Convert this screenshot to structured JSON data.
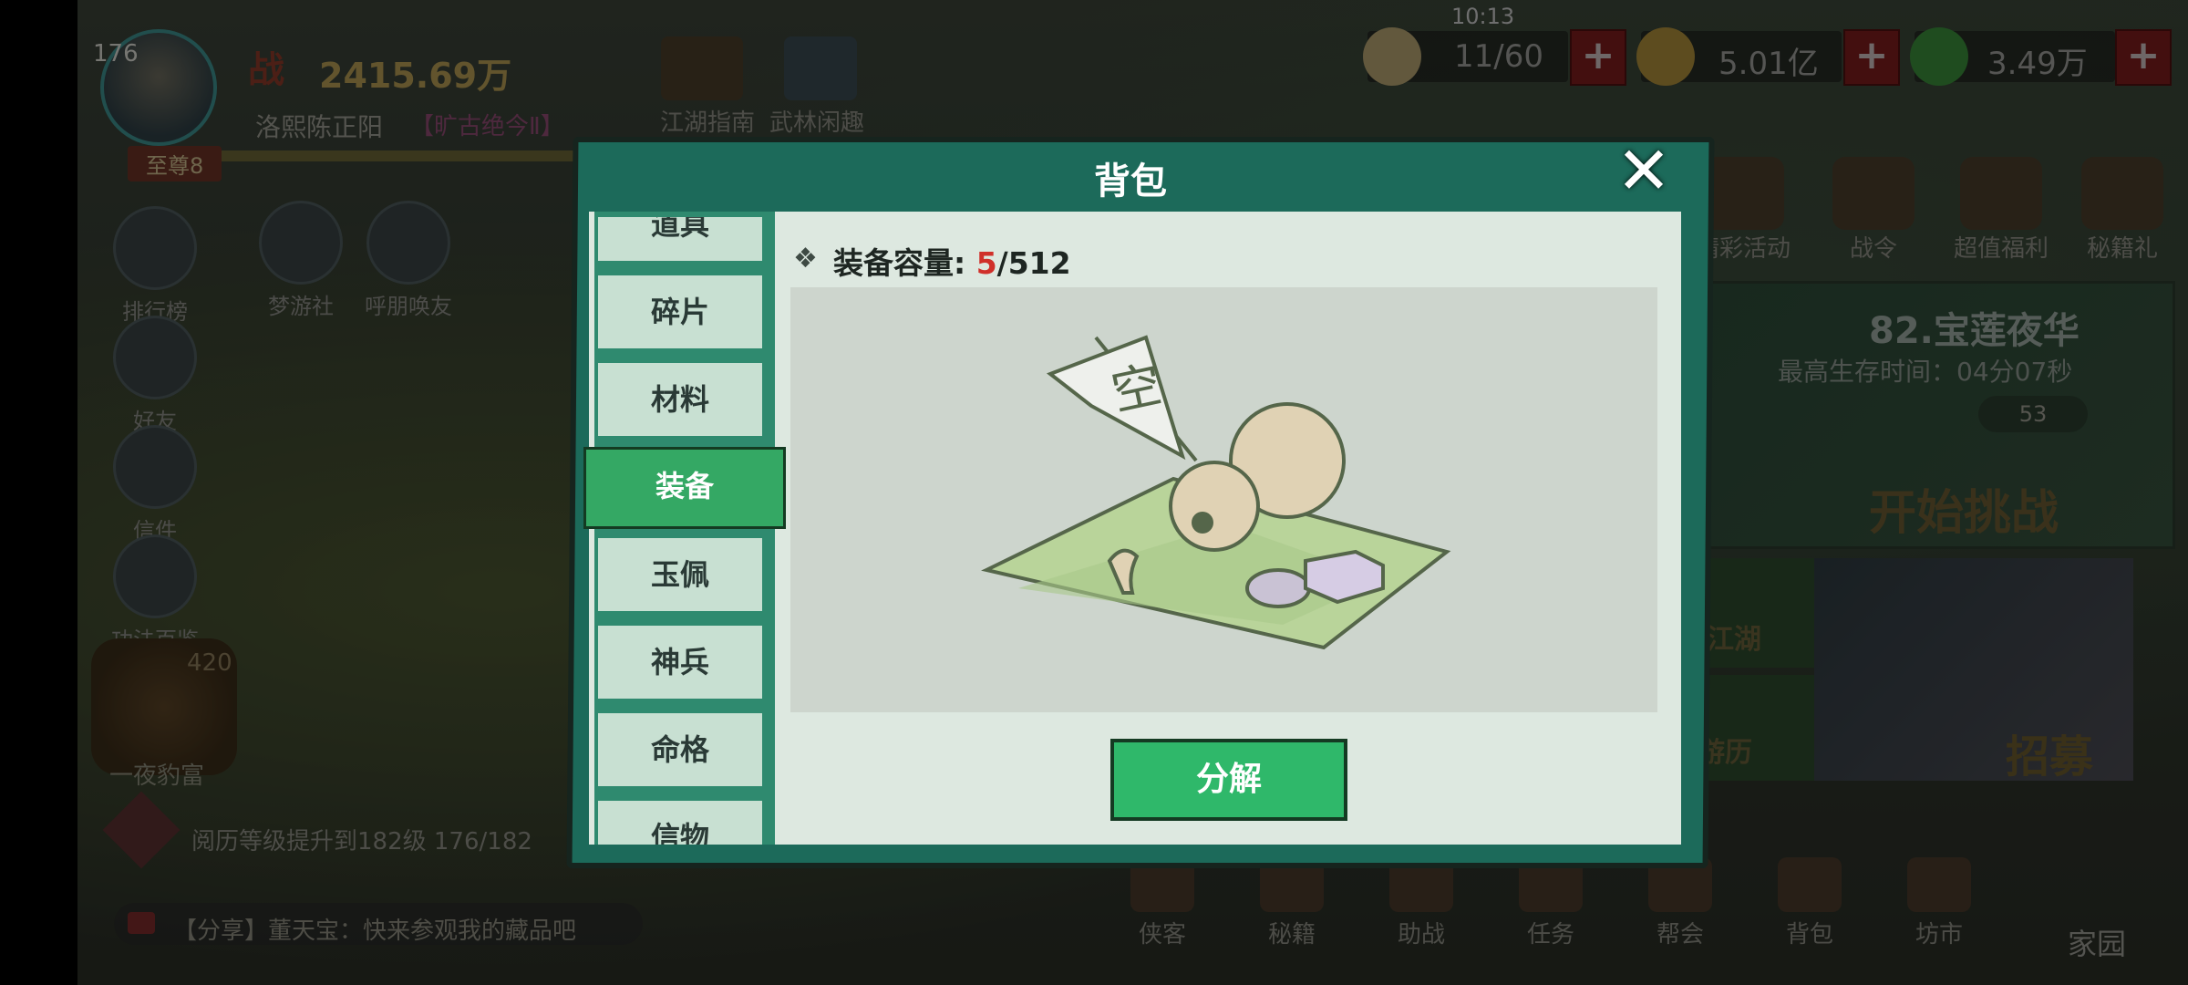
{
  "player": {
    "level": "176",
    "power_icon": "战",
    "power": "2415.69万",
    "name": "洛熙陈正阳",
    "title": "【旷古绝今Ⅱ】",
    "rank": "至尊8"
  },
  "left_menu": [
    {
      "label": "排行榜",
      "icon": "ranking-icon"
    },
    {
      "label": "好友",
      "icon": "friends-icon"
    },
    {
      "label": "信件",
      "icon": "mail-icon"
    },
    {
      "label": "功法百鉴",
      "icon": "book-icon"
    }
  ],
  "top_shortcuts": [
    {
      "label": "梦游社"
    },
    {
      "label": "呼朋唤友"
    },
    {
      "label": "江湖指南"
    },
    {
      "label": "武林闲趣"
    }
  ],
  "status": {
    "clock": "10:13"
  },
  "resources": {
    "stamina": "11/60",
    "coins": "5.01亿",
    "jade": "3.49万",
    "plus": "+"
  },
  "events": [
    {
      "label": "精彩活动"
    },
    {
      "label": "战令"
    },
    {
      "label": "超值福利"
    },
    {
      "label": "秘籍礼"
    }
  ],
  "stage": {
    "title": "82.宝莲夜华",
    "survival": "最高生存时间：04分07秒",
    "count": "53",
    "challenge": "开始挑战"
  },
  "side_panels": {
    "jianghu": "江湖",
    "youli": "游历",
    "recruit": "招募"
  },
  "promo": {
    "num": "420",
    "label": "一夜豹富"
  },
  "quest": "阅历等级提升到182级 176/182",
  "chat": "【分享】董天宝：快来参观我的藏品吧",
  "bottom_nav": [
    {
      "label": "侠客"
    },
    {
      "label": "秘籍"
    },
    {
      "label": "助战"
    },
    {
      "label": "任务"
    },
    {
      "label": "帮会"
    },
    {
      "label": "背包"
    },
    {
      "label": "坊市"
    }
  ],
  "home": "家园",
  "backpack": {
    "title": "背包",
    "close": "✕",
    "tabs": [
      {
        "label": "道具"
      },
      {
        "label": "碎片"
      },
      {
        "label": "材料"
      },
      {
        "label": "装备"
      },
      {
        "label": "玉佩"
      },
      {
        "label": "神兵"
      },
      {
        "label": "命格"
      },
      {
        "label": "信物"
      }
    ],
    "active_tab": "装备",
    "capacity_label": "装备容量: ",
    "capacity_used": "5",
    "capacity_total": "/512",
    "empty_flag_char": "空",
    "decompose": "分解"
  }
}
